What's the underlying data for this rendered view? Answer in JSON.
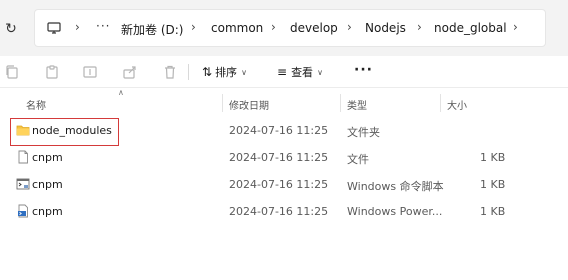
{
  "breadcrumbs": [
    "新加卷 (D:)",
    "common",
    "develop",
    "Nodejs",
    "node_global"
  ],
  "breadcrumb_more": "···",
  "toolbar": {
    "sort_label": "排序",
    "view_label": "查看",
    "more_label": "···"
  },
  "columns": {
    "name": "名称",
    "date": "修改日期",
    "type": "类型",
    "size": "大小"
  },
  "files": [
    {
      "name": "node_modules",
      "date": "2024-07-16 11:25",
      "type": "文件夹",
      "size": "",
      "icon": "folder-icon"
    },
    {
      "name": "cnpm",
      "date": "2024-07-16 11:25",
      "type": "文件",
      "size": "1 KB",
      "icon": "file-icon"
    },
    {
      "name": "cnpm",
      "date": "2024-07-16 11:25",
      "type": "Windows 命令脚本",
      "size": "1 KB",
      "icon": "cmd-script-icon"
    },
    {
      "name": "cnpm",
      "date": "2024-07-16 11:25",
      "type": "Windows Power...",
      "size": "1 KB",
      "icon": "powershell-script-icon"
    }
  ],
  "colors": {
    "highlight": "#d43a3a",
    "folder": "#f6c343"
  }
}
